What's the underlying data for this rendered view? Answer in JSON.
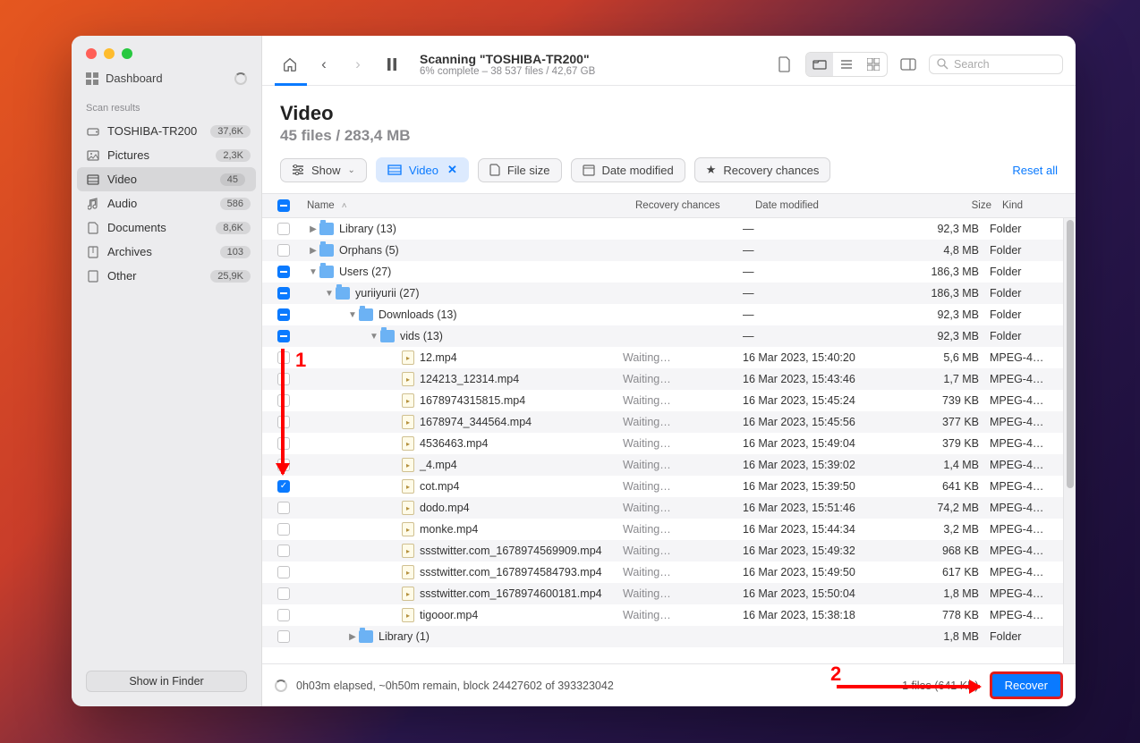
{
  "sidebar": {
    "dashboard_label": "Dashboard",
    "section_label": "Scan results",
    "items": [
      {
        "icon": "disk",
        "label": "TOSHIBA-TR200",
        "badge": "37,6K"
      },
      {
        "icon": "image",
        "label": "Pictures",
        "badge": "2,3K"
      },
      {
        "icon": "video",
        "label": "Video",
        "badge": "45"
      },
      {
        "icon": "music",
        "label": "Audio",
        "badge": "586"
      },
      {
        "icon": "doc",
        "label": "Documents",
        "badge": "8,6K"
      },
      {
        "icon": "archive",
        "label": "Archives",
        "badge": "103"
      },
      {
        "icon": "other",
        "label": "Other",
        "badge": "25,9K"
      }
    ],
    "show_finder": "Show in Finder"
  },
  "toolbar": {
    "scan_title": "Scanning \"TOSHIBA-TR200\"",
    "scan_sub": "6% complete – 38 537 files / 42,67 GB",
    "search_placeholder": "Search"
  },
  "page": {
    "title": "Video",
    "subtitle": "45 files / 283,4 MB"
  },
  "filters": {
    "show": "Show",
    "video": "Video",
    "filesize": "File size",
    "datemod": "Date modified",
    "recoverychance": "Recovery chances",
    "reset": "Reset all"
  },
  "columns": {
    "name": "Name",
    "chances": "Recovery chances",
    "date": "Date modified",
    "size": "Size",
    "kind": "Kind"
  },
  "rows": [
    {
      "indent": 0,
      "check": "none",
      "type": "folder",
      "disc": "right",
      "name": "Library (13)",
      "chances": "",
      "date": "—",
      "size": "92,3 MB",
      "kind": "Folder"
    },
    {
      "indent": 0,
      "check": "none",
      "type": "folder",
      "disc": "right",
      "name": "Orphans (5)",
      "chances": "",
      "date": "—",
      "size": "4,8 MB",
      "kind": "Folder"
    },
    {
      "indent": 0,
      "check": "minus",
      "type": "folder",
      "disc": "down",
      "name": "Users (27)",
      "chances": "",
      "date": "—",
      "size": "186,3 MB",
      "kind": "Folder"
    },
    {
      "indent": 1,
      "check": "minus",
      "type": "folder",
      "disc": "down",
      "name": "yuriiyurii (27)",
      "chances": "",
      "date": "—",
      "size": "186,3 MB",
      "kind": "Folder"
    },
    {
      "indent": 2,
      "check": "minus",
      "type": "folder",
      "disc": "down",
      "name": "Downloads (13)",
      "chances": "",
      "date": "—",
      "size": "92,3 MB",
      "kind": "Folder"
    },
    {
      "indent": 3,
      "check": "minus",
      "type": "folder",
      "disc": "down",
      "name": "vids (13)",
      "chances": "",
      "date": "—",
      "size": "92,3 MB",
      "kind": "Folder"
    },
    {
      "indent": 4,
      "check": "none",
      "type": "file",
      "disc": "",
      "name": "12.mp4",
      "chances": "Waiting…",
      "date": "16 Mar 2023, 15:40:20",
      "size": "5,6 MB",
      "kind": "MPEG-4…"
    },
    {
      "indent": 4,
      "check": "none",
      "type": "file",
      "disc": "",
      "name": "124213_12314.mp4",
      "chances": "Waiting…",
      "date": "16 Mar 2023, 15:43:46",
      "size": "1,7 MB",
      "kind": "MPEG-4…"
    },
    {
      "indent": 4,
      "check": "none",
      "type": "file",
      "disc": "",
      "name": "1678974315815.mp4",
      "chances": "Waiting…",
      "date": "16 Mar 2023, 15:45:24",
      "size": "739 KB",
      "kind": "MPEG-4…"
    },
    {
      "indent": 4,
      "check": "none",
      "type": "file",
      "disc": "",
      "name": "1678974_344564.mp4",
      "chances": "Waiting…",
      "date": "16 Mar 2023, 15:45:56",
      "size": "377 KB",
      "kind": "MPEG-4…"
    },
    {
      "indent": 4,
      "check": "none",
      "type": "file",
      "disc": "",
      "name": "4536463.mp4",
      "chances": "Waiting…",
      "date": "16 Mar 2023, 15:49:04",
      "size": "379 KB",
      "kind": "MPEG-4…"
    },
    {
      "indent": 4,
      "check": "none",
      "type": "file",
      "disc": "",
      "name": "_4.mp4",
      "chances": "Waiting…",
      "date": "16 Mar 2023, 15:39:02",
      "size": "1,4 MB",
      "kind": "MPEG-4…"
    },
    {
      "indent": 4,
      "check": "check",
      "type": "file",
      "disc": "",
      "name": "cot.mp4",
      "chances": "Waiting…",
      "date": "16 Mar 2023, 15:39:50",
      "size": "641 KB",
      "kind": "MPEG-4…"
    },
    {
      "indent": 4,
      "check": "none",
      "type": "file",
      "disc": "",
      "name": "dodo.mp4",
      "chances": "Waiting…",
      "date": "16 Mar 2023, 15:51:46",
      "size": "74,2 MB",
      "kind": "MPEG-4…"
    },
    {
      "indent": 4,
      "check": "none",
      "type": "file",
      "disc": "",
      "name": "monke.mp4",
      "chances": "Waiting…",
      "date": "16 Mar 2023, 15:44:34",
      "size": "3,2 MB",
      "kind": "MPEG-4…"
    },
    {
      "indent": 4,
      "check": "none",
      "type": "file",
      "disc": "",
      "name": "ssstwitter.com_1678974569909.mp4",
      "chances": "Waiting…",
      "date": "16 Mar 2023, 15:49:32",
      "size": "968 KB",
      "kind": "MPEG-4…"
    },
    {
      "indent": 4,
      "check": "none",
      "type": "file",
      "disc": "",
      "name": "ssstwitter.com_1678974584793.mp4",
      "chances": "Waiting…",
      "date": "16 Mar 2023, 15:49:50",
      "size": "617 KB",
      "kind": "MPEG-4…"
    },
    {
      "indent": 4,
      "check": "none",
      "type": "file",
      "disc": "",
      "name": "ssstwitter.com_1678974600181.mp4",
      "chances": "Waiting…",
      "date": "16 Mar 2023, 15:50:04",
      "size": "1,8 MB",
      "kind": "MPEG-4…"
    },
    {
      "indent": 4,
      "check": "none",
      "type": "file",
      "disc": "",
      "name": "tigooor.mp4",
      "chances": "Waiting…",
      "date": "16 Mar 2023, 15:38:18",
      "size": "778 KB",
      "kind": "MPEG-4…"
    },
    {
      "indent": 2,
      "check": "none",
      "type": "folder",
      "disc": "right",
      "name": "Library (1)",
      "chances": "",
      "date": "",
      "size": "1,8 MB",
      "kind": "Folder"
    }
  ],
  "footer": {
    "status": "0h03m elapsed, ~0h50m remain, block 24427602 of 393323042",
    "selection": "1 files (641 KB)",
    "recover": "Recover"
  },
  "annotations": {
    "marker1": "1",
    "marker2": "2"
  }
}
